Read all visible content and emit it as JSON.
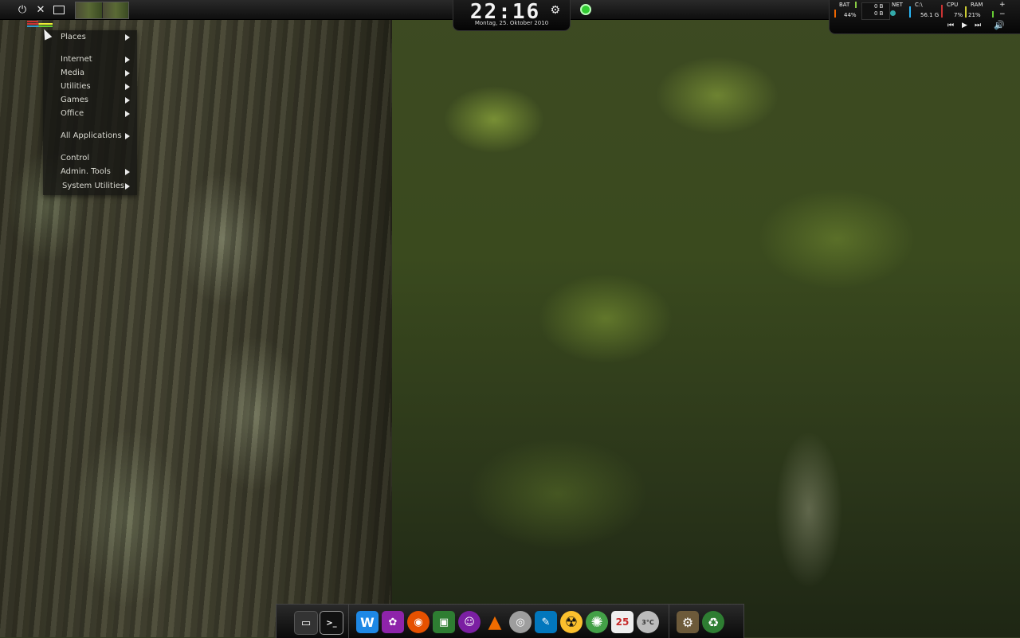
{
  "top_panel": {
    "power_icon": "power-icon",
    "close_icon": "close-icon",
    "window_icon": "window-icon",
    "workspaces": 2
  },
  "clock": {
    "time": "22:16",
    "date": "Montag, 25. Oktober 2010"
  },
  "sysmon": {
    "bat_label": "BAT",
    "bat_value": "44%",
    "net_down": "0 B",
    "net_up": "0 B",
    "net_label": "NET",
    "disk_label": "C:\\",
    "disk_value": "56.1 G",
    "cpu_label": "CPU",
    "cpu_value": "7%",
    "ram_label": "RAM",
    "ram_value": "21%",
    "plus": "+",
    "minus": "−"
  },
  "menu": {
    "items": [
      {
        "label": "Places",
        "arrow": true
      },
      {
        "label": "Internet",
        "arrow": true
      },
      {
        "label": "Media",
        "arrow": true
      },
      {
        "label": "Utilities",
        "arrow": true
      },
      {
        "label": "Games",
        "arrow": true
      },
      {
        "label": "Office",
        "arrow": true
      },
      {
        "label": "All Applications",
        "arrow": true
      },
      {
        "label": "Control",
        "arrow": false
      },
      {
        "label": "Admin. Tools",
        "arrow": true
      },
      {
        "label": "System Utilities",
        "arrow": true
      }
    ]
  },
  "dock": {
    "icons": [
      {
        "name": "terminal-tab-icon",
        "color": "#444"
      },
      {
        "name": "terminal-icon",
        "color": "#222"
      },
      {
        "name": "writer-icon",
        "color": "#1e88e5",
        "glyph": "W"
      },
      {
        "name": "gimp-icon",
        "color": "#8e24aa",
        "glyph": "✿"
      },
      {
        "name": "firefox-icon",
        "color": "#e65100",
        "glyph": "◉"
      },
      {
        "name": "image-editor-icon",
        "color": "#2e7d32",
        "glyph": "▣"
      },
      {
        "name": "pidgin-icon",
        "color": "#7b1fa2",
        "glyph": "☺"
      },
      {
        "name": "vlc-icon",
        "color": "#ef6c00",
        "glyph": "▲"
      },
      {
        "name": "disc-burner-icon",
        "color": "#9e9e9e",
        "glyph": "◎"
      },
      {
        "name": "gedit-icon",
        "color": "#0277bd",
        "glyph": "✎"
      },
      {
        "name": "radiation-icon",
        "color": "#fbc02d",
        "glyph": "☢"
      },
      {
        "name": "lime-icon",
        "color": "#43a047",
        "glyph": "✺"
      },
      {
        "name": "calendar-icon",
        "color": "#c62828",
        "glyph": "25"
      },
      {
        "name": "weather-icon",
        "color": "#9e9e9e",
        "glyph": "3°C"
      },
      {
        "name": "settings-icon",
        "color": "#6d5a3a",
        "glyph": "⚙"
      },
      {
        "name": "trash-icon",
        "color": "#2e7d32",
        "glyph": "♻"
      }
    ]
  }
}
